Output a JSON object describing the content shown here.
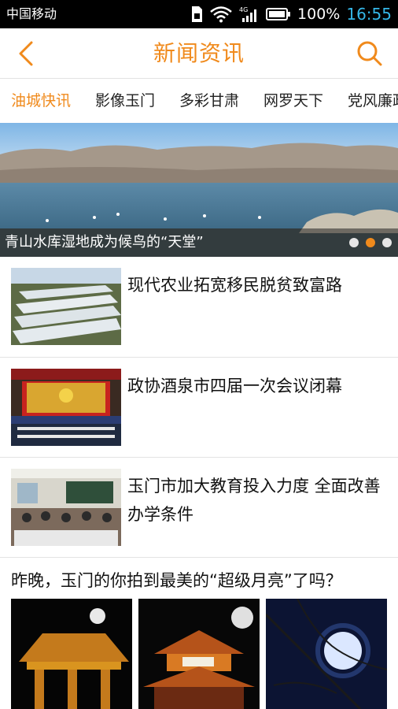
{
  "status_bar": {
    "carrier": "中国移动",
    "network": "4G",
    "battery": "100%",
    "time": "16:55"
  },
  "header": {
    "title": "新闻资讯",
    "back_icon": "chevron-left-icon",
    "search_icon": "search-icon"
  },
  "tabs": [
    {
      "label": "油城快讯",
      "active": true
    },
    {
      "label": "影像玉门",
      "active": false
    },
    {
      "label": "多彩甘肃",
      "active": false
    },
    {
      "label": "网罗天下",
      "active": false
    },
    {
      "label": "党风廉政",
      "active": false
    }
  ],
  "banner": {
    "caption": "青山水库湿地成为候鸟的“天堂”",
    "slide_count": 3,
    "active_slide": 2
  },
  "news": [
    {
      "headline": "现代农业拓宽移民脱贫致富路"
    },
    {
      "headline": "政协酒泉市四届一次会议闭幕"
    },
    {
      "headline": "玉门市加大教育投入力度  全面改善办学条件"
    }
  ],
  "gallery": {
    "title": "昨晚，玉门的你拍到最美的“超级月亮”了吗？"
  },
  "colors": {
    "accent": "#f08a1c",
    "clock": "#35b7e8",
    "divider": "#e3e3e3"
  }
}
